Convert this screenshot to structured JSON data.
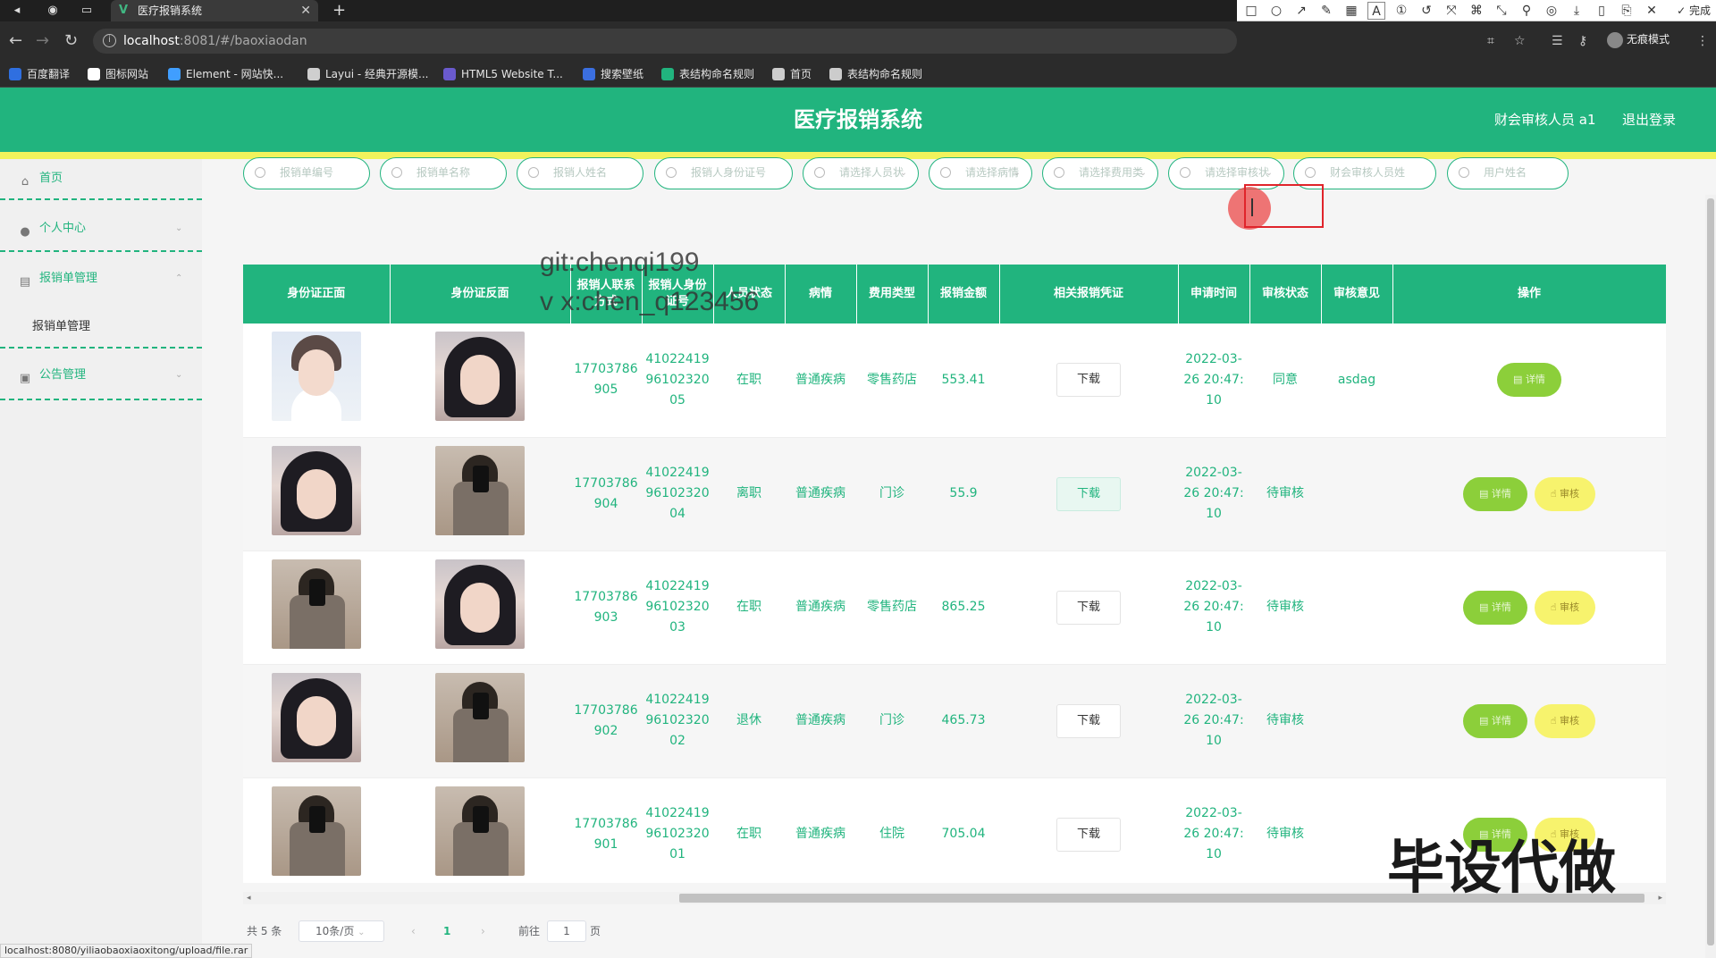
{
  "browser": {
    "tab_title": "医疗报销系统",
    "url_host": "localhost",
    "url_rest": ":8081/#/baoxiaodan",
    "incognito_label": "无痕模式",
    "bookmarks": [
      {
        "label": "百度翻译",
        "color": "#2f6fe0"
      },
      {
        "label": "图标网站",
        "color": "#ffffff"
      },
      {
        "label": "Element - 网站快...",
        "color": "#409eff"
      },
      {
        "label": "Layui - 经典开源模...",
        "color": "#cfcfcf"
      },
      {
        "label": "HTML5 Website T...",
        "color": "#6a5acd"
      },
      {
        "label": "搜索壁纸",
        "color": "#3b6fe0"
      },
      {
        "label": "表结构命名规则",
        "color": "#21b47e"
      },
      {
        "label": "首页",
        "color": "#cccccc"
      },
      {
        "label": "表结构命名规则",
        "color": "#cccccc"
      }
    ],
    "status_url": "localhost:8080/yiliaobaoxiaoxitong/upload/file.rar"
  },
  "screenshot_tool": {
    "font_size": "20",
    "done_label": "完成",
    "swatches": [
      "#000000",
      "#7f7f7f",
      "#880015",
      "#ed1c24",
      "#ff7f27",
      "#fff200",
      "#22b14c",
      "#3f48cc",
      "#a349a4",
      "#00a2e8",
      "#ffffff",
      "#c3c3c3",
      "#b97a57",
      "#ffaec9",
      "#ffc90e",
      "#efe4b0",
      "#b5e61d",
      "#99d9ea",
      "#7092be",
      "#c8bfe7"
    ]
  },
  "header": {
    "title": "医疗报销系统",
    "user_label": "财会审核人员 a1",
    "logout_label": "退出登录"
  },
  "sidebar": {
    "items": [
      {
        "label": "首页",
        "icon": "home-icon"
      },
      {
        "label": "个人中心",
        "icon": "user-icon"
      },
      {
        "label": "报销单管理",
        "icon": "message-icon"
      },
      {
        "label": "公告管理",
        "icon": "notice-icon"
      }
    ],
    "sub_item": "报销单管理"
  },
  "search": {
    "placeholders": [
      "报销单编号",
      "报销单名称",
      "报销人姓名",
      "报销人身份证号",
      "请选择人员状",
      "请选择病情",
      "请选择费用类",
      "请选择审核状",
      "财会审核人员姓",
      "用户姓名"
    ]
  },
  "table": {
    "headers": [
      "身份证正面",
      "身份证反面",
      "报销人联系方式",
      "报销人身份证号",
      "人员状态",
      "病情",
      "费用类型",
      "报销金额",
      "相关报销凭证",
      "申请时间",
      "审核状态",
      "审核意见",
      "操作"
    ],
    "download_label": "下载",
    "detail_label": "详情",
    "audit_label": "审核",
    "rows": [
      {
        "front": "boy",
        "back": "girl",
        "phone": "17703786905",
        "id_no": "410224199610232005",
        "status": "在职",
        "illness": "普通疾病",
        "fee_type": "零售药店",
        "amount": "553.41",
        "time": "2022-03-26 20:47:10",
        "audit_status": "同意",
        "opinion": "asdag",
        "can_audit": false
      },
      {
        "front": "girl",
        "back": "selfie",
        "phone": "17703786904",
        "id_no": "410224199610232004",
        "status": "离职",
        "illness": "普通疾病",
        "fee_type": "门诊",
        "amount": "55.9",
        "time": "2022-03-26 20:47:10",
        "audit_status": "待审核",
        "opinion": "",
        "can_audit": true
      },
      {
        "front": "selfie",
        "back": "girl",
        "phone": "17703786903",
        "id_no": "410224199610232003",
        "status": "在职",
        "illness": "普通疾病",
        "fee_type": "零售药店",
        "amount": "865.25",
        "time": "2022-03-26 20:47:10",
        "audit_status": "待审核",
        "opinion": "",
        "can_audit": true
      },
      {
        "front": "girl",
        "back": "selfie",
        "phone": "17703786902",
        "id_no": "410224199610232002",
        "status": "退休",
        "illness": "普通疾病",
        "fee_type": "门诊",
        "amount": "465.73",
        "time": "2022-03-26 20:47:10",
        "audit_status": "待审核",
        "opinion": "",
        "can_audit": true
      },
      {
        "front": "selfie",
        "back": "selfie",
        "phone": "17703786901",
        "id_no": "410224199610232001",
        "status": "在职",
        "illness": "普通疾病",
        "fee_type": "住院",
        "amount": "705.04",
        "time": "2022-03-26 20:47:10",
        "audit_status": "待审核",
        "opinion": "",
        "can_audit": true
      }
    ]
  },
  "pagination": {
    "total_label": "共 5 条",
    "page_size_label": "10条/页",
    "current_page": "1",
    "goto_prefix": "前往",
    "goto_value": "1",
    "goto_suffix": "页"
  },
  "watermarks": {
    "line1": "git:chenqi199",
    "line2": "v x:chen_q123456",
    "corner": "毕设代做"
  },
  "colors": {
    "primary": "#21b47e",
    "accent_yellow": "#f1f35c",
    "detail_btn": "#8ccf3a",
    "audit_btn": "#f7f36d"
  }
}
